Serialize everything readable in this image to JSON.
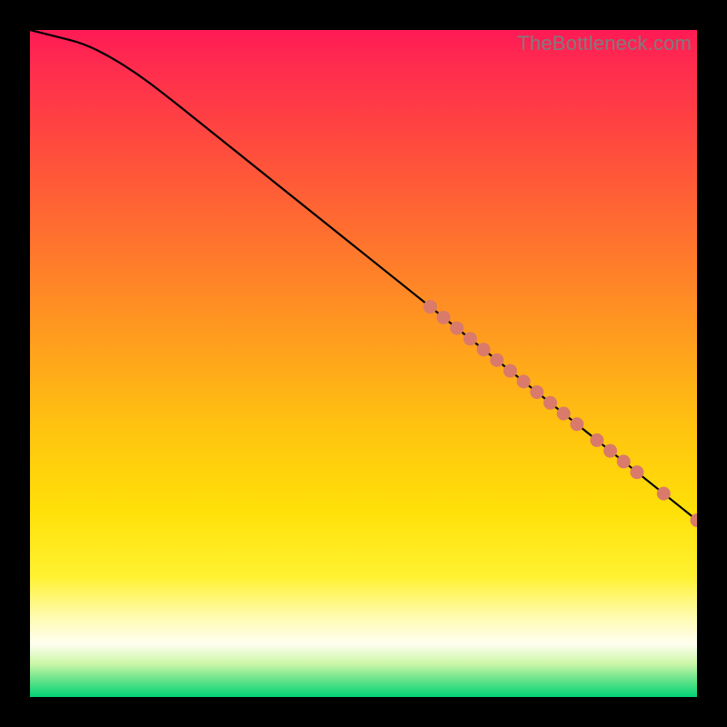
{
  "watermark": "TheBottleneck.com",
  "chart_data": {
    "type": "line",
    "title": "",
    "xlabel": "",
    "ylabel": "",
    "xlim": [
      0,
      100
    ],
    "ylim": [
      0,
      100
    ],
    "curve": {
      "name": "bottleneck-curve",
      "x": [
        0,
        4,
        8,
        12,
        16,
        20,
        25,
        30,
        35,
        40,
        45,
        50,
        55,
        60,
        65,
        70,
        75,
        80,
        85,
        90,
        95,
        100
      ],
      "y": [
        100,
        99,
        98,
        96,
        93.5,
        90.5,
        86.5,
        82.5,
        78.5,
        74.5,
        70.5,
        66.5,
        62.5,
        58.5,
        54.5,
        50.5,
        46.5,
        42.5,
        38.5,
        34.5,
        30.5,
        26.5
      ]
    },
    "highlight_points": {
      "name": "highlighted-segment",
      "color": "#d97a6a",
      "x": [
        60,
        62,
        64,
        66,
        68,
        70,
        72,
        74,
        76,
        78,
        80,
        82,
        85,
        87,
        89,
        91,
        95,
        100
      ],
      "y": [
        58.5,
        56.9,
        55.3,
        53.7,
        52.1,
        50.5,
        48.9,
        47.3,
        45.7,
        44.1,
        42.5,
        40.9,
        38.5,
        36.9,
        35.3,
        33.7,
        30.5,
        26.5
      ]
    }
  }
}
